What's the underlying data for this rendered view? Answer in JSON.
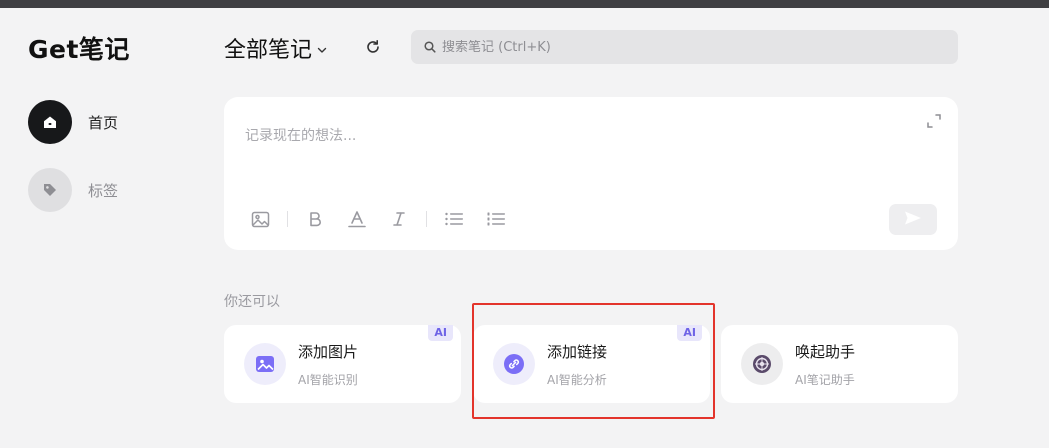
{
  "app": {
    "logo": "Get笔记"
  },
  "sidebar": {
    "items": [
      {
        "label": "首页",
        "icon": "home-icon",
        "active": true
      },
      {
        "label": "标签",
        "icon": "tag-icon",
        "active": false
      }
    ]
  },
  "header": {
    "title": "全部笔记",
    "search_placeholder": "搜索笔记 (Ctrl+K)"
  },
  "editor": {
    "placeholder": "记录现在的想法..."
  },
  "suggestions": {
    "label": "你还可以",
    "cards": [
      {
        "title": "添加图片",
        "subtitle": "AI智能识别",
        "badge": "AI",
        "icon": "image-icon"
      },
      {
        "title": "添加链接",
        "subtitle": "AI智能分析",
        "badge": "AI",
        "icon": "link-icon"
      },
      {
        "title": "唤起助手",
        "subtitle": "AI笔记助手",
        "badge": "",
        "icon": "assistant-icon"
      }
    ]
  },
  "colors": {
    "accent": "#7b6ef6",
    "highlight": "#e3342b",
    "ai_badge_bg": "#e8e6fb",
    "ai_badge_text": "#6e63e6"
  }
}
